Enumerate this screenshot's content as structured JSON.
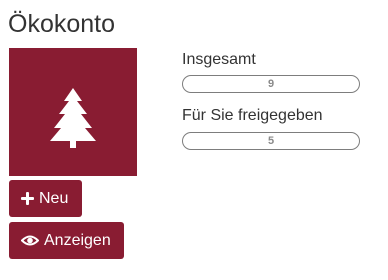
{
  "title": "Ökokonto",
  "tile": {
    "icon": "tree-icon",
    "color": "#891c32"
  },
  "buttons": {
    "new_label": "Neu",
    "new_icon": "plus-icon",
    "view_label": "Anzeigen",
    "view_icon": "eye-icon"
  },
  "stats": [
    {
      "label": "Insgesamt",
      "value": "9",
      "fill_fraction": 0
    },
    {
      "label": "Für Sie freigegeben",
      "value": "5",
      "fill_fraction": 0
    }
  ],
  "colors": {
    "accent": "#891c32",
    "bar_border": "#7d7d7d",
    "bar_text": "#8a8a8a"
  }
}
